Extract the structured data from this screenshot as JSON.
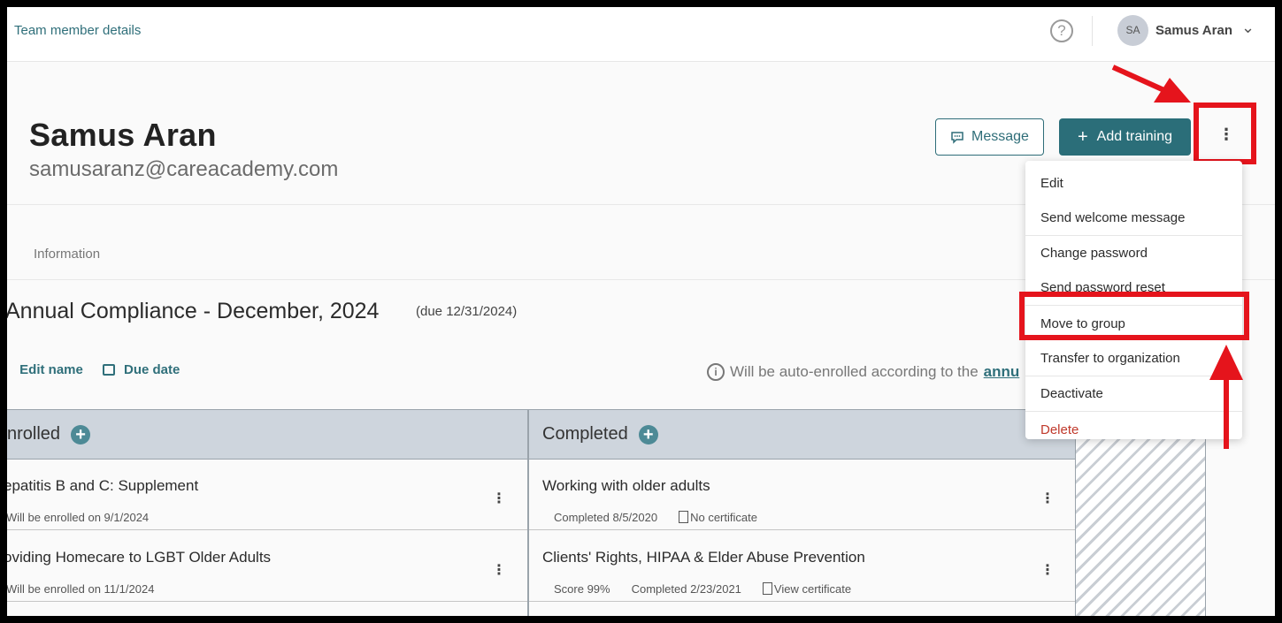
{
  "topbar": {
    "breadcrumb": "Team member details",
    "help_icon": "question-circle-icon",
    "user": {
      "initials": "SA",
      "name": "Samus Aran",
      "chevron": "⌄"
    }
  },
  "profile": {
    "name": "Samus Aran",
    "email": "samusaranz@careacademy.com",
    "message_label": "Message",
    "add_training_label": "Add training",
    "more_icon": "⋮"
  },
  "tabs": {
    "info_label": "Information"
  },
  "section": {
    "title": "Annual Compliance - December, 2024",
    "due": "(due 12/31/2024)",
    "edit_name": "Edit name",
    "due_date": "Due date",
    "auto_note": "Will be auto-enrolled according to the",
    "auto_link": "annu"
  },
  "table": {
    "enrolled_header": "nrolled",
    "completed_header": "Completed",
    "enrolled_rows": [
      {
        "title": "epatitis B and C: Supplement",
        "sub": "Will be enrolled on 9/1/2024"
      },
      {
        "title": "oviding Homecare to LGBT Older Adults",
        "sub": "Will be enrolled on 11/1/2024"
      }
    ],
    "completed_rows": [
      {
        "title": "Working with older adults",
        "date": "Completed 8/5/2020",
        "cert": "No certificate"
      },
      {
        "title": "Clients' Rights, HIPAA & Elder Abuse Prevention",
        "score": "Score 99%",
        "date": "Completed 2/23/2021",
        "cert": "View certificate"
      }
    ]
  },
  "menu": {
    "edit": "Edit",
    "send_welcome": "Send welcome message",
    "change_password": "Change password",
    "send_reset": "Send password reset",
    "move_to_group": "Move to group",
    "transfer": "Transfer to organization",
    "deactivate": "Deactivate",
    "delete": "Delete"
  },
  "colors": {
    "accent": "#2b6e79",
    "annotation_red": "#e5141c",
    "danger": "#c0392b"
  }
}
